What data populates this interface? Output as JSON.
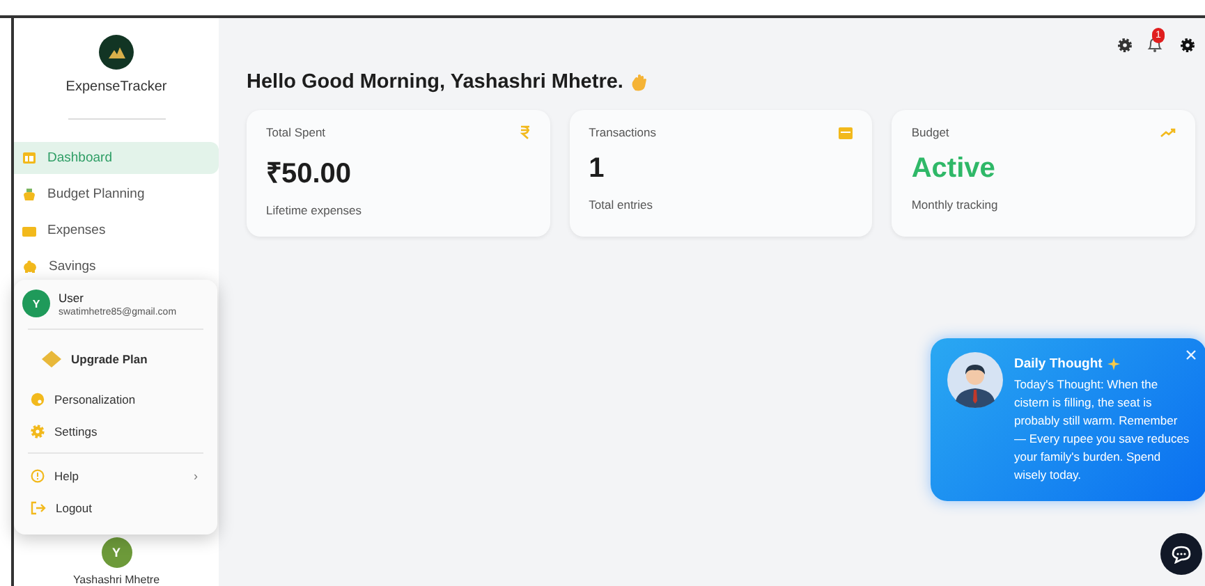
{
  "app": {
    "name": "ExpenseTracker"
  },
  "nav": [
    {
      "kind": "dashboard",
      "label": "Dashboard",
      "selected": true
    },
    {
      "kind": "budget",
      "label": "Budget Planning",
      "selected": false
    },
    {
      "kind": "expenses",
      "label": "Expenses",
      "selected": false
    },
    {
      "kind": "savings",
      "label": "Savings",
      "selected": false
    }
  ],
  "profile_menu": {
    "avatar": "Y",
    "name": "User",
    "email": "swatimhetre85@gmail.com",
    "items": [
      {
        "kind": "upgrade",
        "label": "Upgrade Plan"
      },
      {
        "kind": "palette",
        "label": "Personalization"
      },
      {
        "kind": "settings",
        "label": "Settings"
      },
      {
        "kind": "help",
        "label": "Help",
        "arrow": "›"
      },
      {
        "kind": "logout",
        "label": "Logout"
      }
    ]
  },
  "sidebar_user": {
    "avatar": "Y",
    "name": "Yashashri Mhetre"
  },
  "header": {
    "notification_count": "1"
  },
  "greeting": "Hello Good Morning, Yashashri Mhetre.",
  "cards": [
    {
      "kind": "rupee",
      "label": "Total Spent",
      "value": "₹50.00",
      "caption": "Lifetime expenses"
    },
    {
      "kind": "calendar",
      "label": "Transactions",
      "value": "1",
      "caption": "Total entries"
    },
    {
      "kind": "status",
      "label": "Budget",
      "value": "Active",
      "caption": "Monthly tracking"
    }
  ],
  "daily_thought": {
    "title": "Daily Thought",
    "text": "Today's Thought: When the cistern is filling, the seat is probably still warm. Remember — Every rupee you save reduces your family's burden. Spend wisely today."
  }
}
